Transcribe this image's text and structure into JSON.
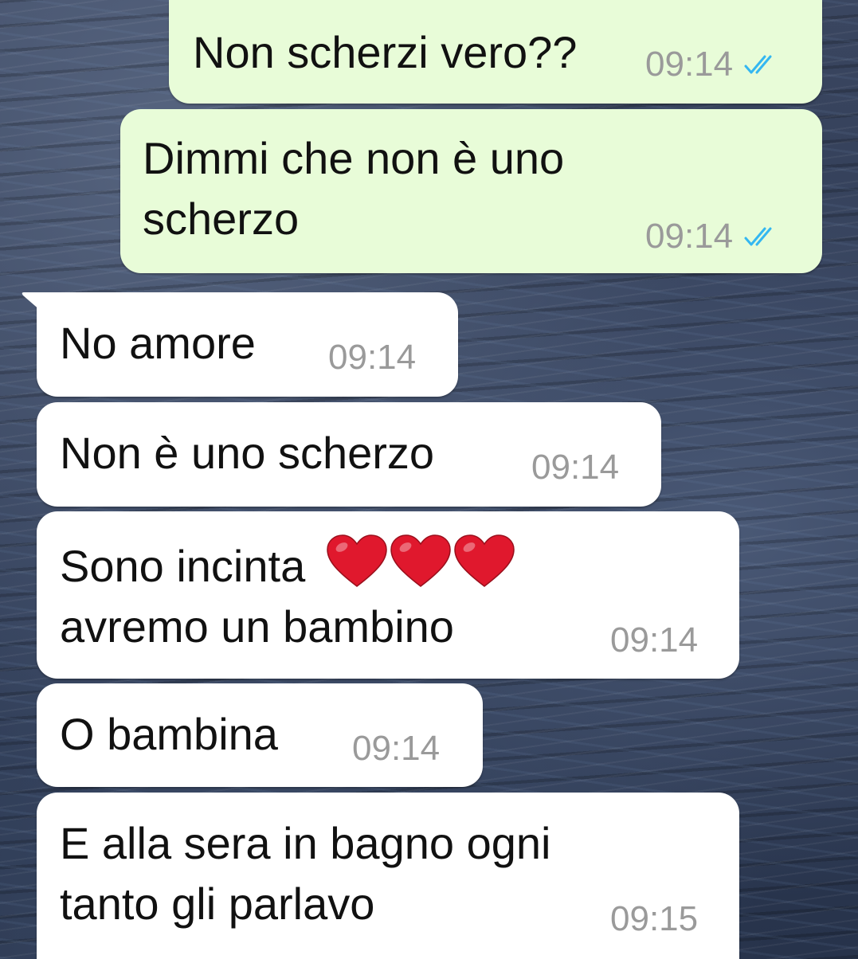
{
  "messages": [
    {
      "text": "Non scherzi vero??",
      "time": "09:14",
      "status_icon": "double-check-read-icon"
    },
    {
      "text": "Dimmi che non è uno\nscherzo",
      "time": "09:14",
      "status_icon": "double-check-read-icon"
    },
    {
      "text": "No amore",
      "time": "09:14"
    },
    {
      "text": "Non è uno scherzo",
      "time": "09:14"
    },
    {
      "text_line1": "Sono incinta",
      "emoji": "❤️❤️❤️",
      "text_line2": "avremo un bambino",
      "time": "09:14"
    },
    {
      "text": "O bambina",
      "time": "09:14"
    },
    {
      "text": "E alla sera in bagno ogni\ntanto gli parlavo",
      "time": "09:15"
    }
  ],
  "colors": {
    "outgoing_bubble": "#e8fcd8",
    "incoming_bubble": "#ffffff",
    "read_ticks": "#34b7f1",
    "timestamp": "#9a9a9a",
    "heart": "#e0182d"
  }
}
